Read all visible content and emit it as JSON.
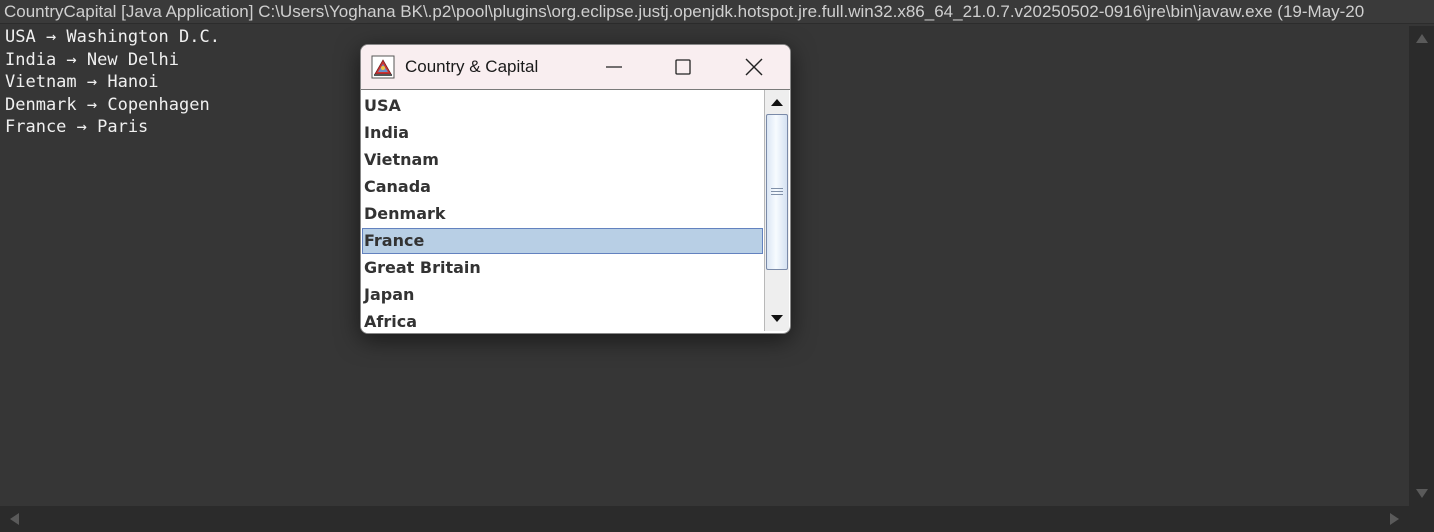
{
  "console": {
    "title": "CountryCapital [Java Application] C:\\Users\\Yoghana BK\\.p2\\pool\\plugins\\org.eclipse.justj.openjdk.hotspot.jre.full.win32.x86_64_21.0.7.v20250502-0916\\jre\\bin\\javaw.exe  (19-May-20",
    "lines": [
      "USA → Washington D.C.",
      "India → New Delhi",
      "Vietnam → Hanoi",
      "Denmark → Copenhagen",
      "France → Paris"
    ]
  },
  "dialog": {
    "title": "Country & Capital",
    "icon": "java-app-icon",
    "buttons": {
      "minimize": "minimize-icon",
      "maximize": "maximize-icon",
      "close": "close-icon"
    },
    "countries": [
      "USA",
      "India",
      "Vietnam",
      "Canada",
      "Denmark",
      "France",
      "Great Britain",
      "Japan",
      "Africa"
    ],
    "selected": "France"
  },
  "colors": {
    "console_bg": "#363636",
    "console_text": "#f0f0f0",
    "selection_bg": "#b8cfe5",
    "selection_border": "#6382bf",
    "titlebar_bg": "#f9eef0"
  }
}
